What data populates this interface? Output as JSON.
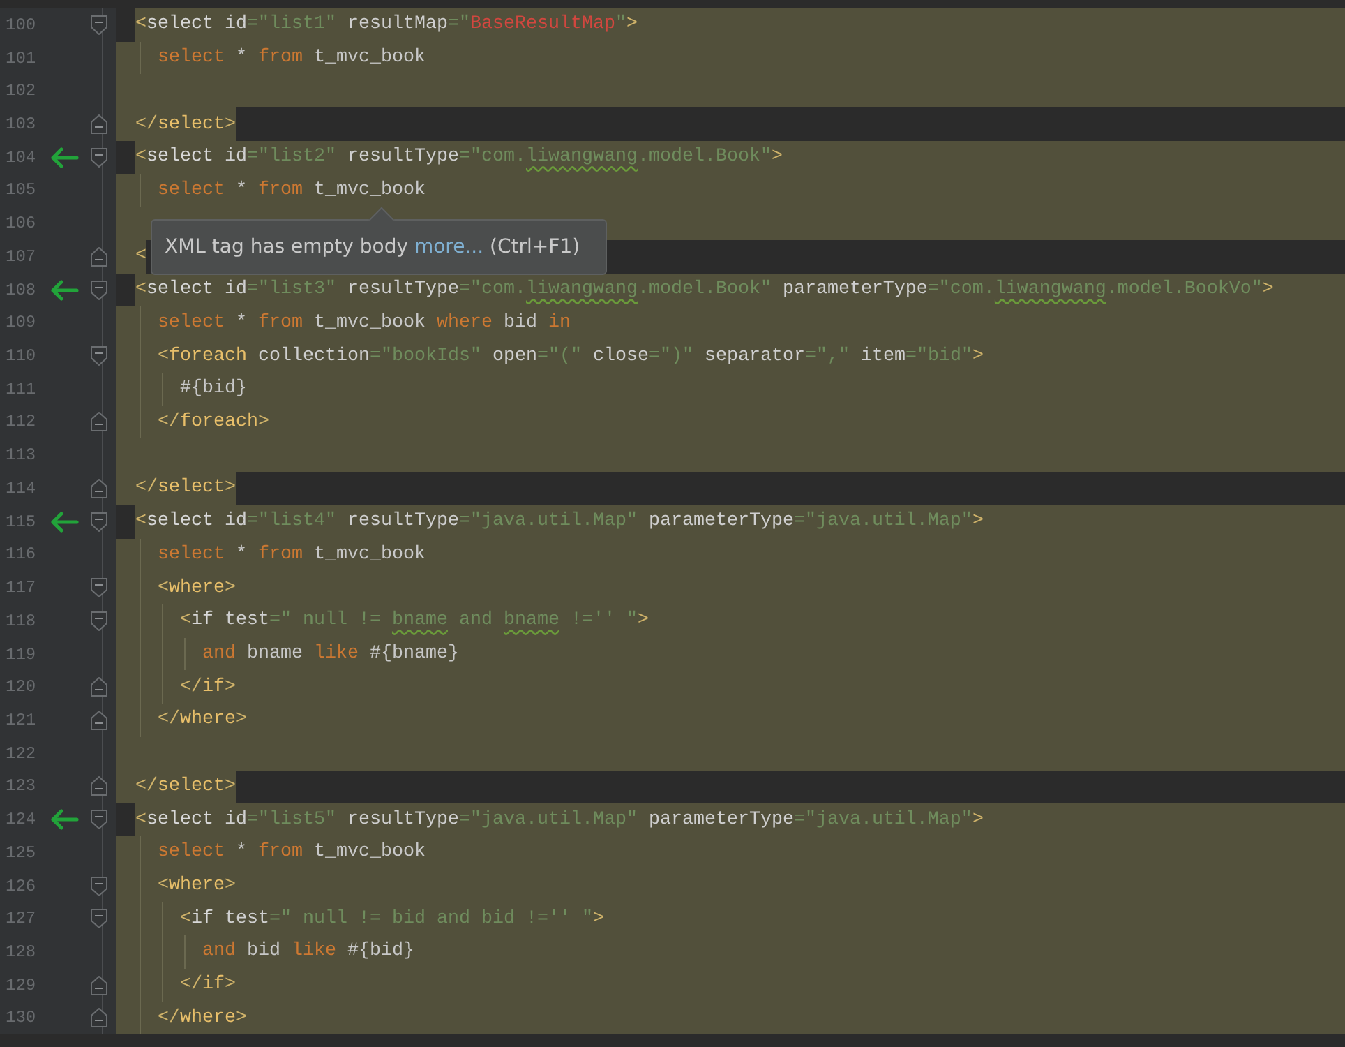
{
  "lines": [
    {
      "number": "100",
      "marker": false,
      "tokens": [
        {
          "kind": "bracket",
          "text": "<"
        },
        {
          "kind": "tag-plain",
          "text": "select"
        },
        {
          "kind": "attr",
          "text": " id"
        },
        {
          "kind": "value",
          "text": "=\"list1\""
        },
        {
          "kind": "attr",
          "text": " resultMap"
        },
        {
          "kind": "value",
          "text": "=\""
        },
        {
          "kind": "error",
          "text": "BaseResultMap"
        },
        {
          "kind": "value",
          "text": "\""
        },
        {
          "kind": "bracket",
          "text": ">"
        }
      ],
      "children": [
        {
          "number": "101",
          "marker": false,
          "tokens": [
            {
              "kind": "keyword",
              "text": "select"
            },
            {
              "kind": "text",
              "text": " * "
            },
            {
              "kind": "keyword",
              "text": "from"
            },
            {
              "kind": "text",
              "text": " t_mvc_book"
            }
          ]
        },
        {
          "number": "102",
          "marker": false
        }
      ]
    },
    {
      "number": "103",
      "marker": false,
      "tokens": [
        {
          "kind": "bracket",
          "text": "</"
        },
        {
          "kind": "tag",
          "text": "select"
        },
        {
          "kind": "bracket",
          "text": ">"
        }
      ]
    },
    {
      "number": "104",
      "marker": true,
      "tokens": [
        {
          "kind": "bracket",
          "text": "<"
        },
        {
          "kind": "tag-plain",
          "text": "select"
        },
        {
          "kind": "attr",
          "text": " id"
        },
        {
          "kind": "value",
          "text": "=\"list2\""
        },
        {
          "kind": "attr",
          "text": " resultType"
        },
        {
          "kind": "value",
          "text": "=\"com."
        },
        {
          "kind": "value",
          "text": "liwangwang",
          "warning": true
        },
        {
          "kind": "value",
          "text": ".model.Book\""
        },
        {
          "kind": "bracket",
          "text": ">"
        }
      ],
      "children": [
        {
          "number": "105",
          "marker": false,
          "tokens": [
            {
              "kind": "keyword",
              "text": "select"
            },
            {
              "kind": "text",
              "text": " * "
            },
            {
              "kind": "keyword",
              "text": "from"
            },
            {
              "kind": "text",
              "text": " t_mvc_book"
            }
          ]
        },
        {
          "number": "106",
          "marker": false
        }
      ]
    },
    {
      "number": "107",
      "marker": false,
      "tokens": [
        {
          "kind": "bracket",
          "text": "<"
        }
      ]
    },
    {
      "number": "108",
      "marker": true,
      "tokens": [
        {
          "kind": "bracket",
          "text": "<"
        },
        {
          "kind": "tag-plain",
          "text": "select"
        },
        {
          "kind": "attr",
          "text": " id"
        },
        {
          "kind": "value",
          "text": "=\"list3\""
        },
        {
          "kind": "attr",
          "text": " resultType"
        },
        {
          "kind": "value",
          "text": "=\"com."
        },
        {
          "kind": "value",
          "text": "liwangwang",
          "warning": true
        },
        {
          "kind": "value",
          "text": ".model.Book\""
        },
        {
          "kind": "attr",
          "text": " parameterType"
        },
        {
          "kind": "value",
          "text": "=\"com."
        },
        {
          "kind": "value",
          "text": "liwangwang",
          "warning": true
        },
        {
          "kind": "value",
          "text": ".model.BookVo\""
        },
        {
          "kind": "bracket",
          "text": ">"
        }
      ],
      "children": [
        {
          "number": "109",
          "marker": false,
          "tokens": [
            {
              "kind": "keyword",
              "text": "select"
            },
            {
              "kind": "text",
              "text": " * "
            },
            {
              "kind": "keyword",
              "text": "from"
            },
            {
              "kind": "text",
              "text": " t_mvc_book "
            },
            {
              "kind": "keyword",
              "text": "where"
            },
            {
              "kind": "text",
              "text": " bid "
            },
            {
              "kind": "keyword",
              "text": "in"
            }
          ]
        },
        {
          "number": "110",
          "marker": false,
          "tokens": [
            {
              "kind": "bracket",
              "text": "<"
            },
            {
              "kind": "tag",
              "text": "foreach"
            },
            {
              "kind": "attr",
              "text": " collection"
            },
            {
              "kind": "value",
              "text": "=\"bookIds\""
            },
            {
              "kind": "attr",
              "text": " open"
            },
            {
              "kind": "value",
              "text": "=\"(\""
            },
            {
              "kind": "attr",
              "text": " close"
            },
            {
              "kind": "value",
              "text": "=\")\""
            },
            {
              "kind": "attr",
              "text": " separator"
            },
            {
              "kind": "value",
              "text": "=\",\""
            },
            {
              "kind": "attr",
              "text": " item"
            },
            {
              "kind": "value",
              "text": "=\"bid\""
            },
            {
              "kind": "bracket",
              "text": ">"
            }
          ],
          "children": [
            {
              "number": "111",
              "marker": false,
              "tokens": [
                {
                  "kind": "text",
                  "text": "#{bid}"
                }
              ]
            }
          ]
        },
        {
          "number": "112",
          "marker": false,
          "tokens": [
            {
              "kind": "bracket",
              "text": "</"
            },
            {
              "kind": "tag",
              "text": "foreach"
            },
            {
              "kind": "bracket",
              "text": ">"
            }
          ]
        },
        {
          "number": "113",
          "marker": false
        }
      ]
    },
    {
      "number": "114",
      "marker": false,
      "tokens": [
        {
          "kind": "bracket",
          "text": "</"
        },
        {
          "kind": "tag",
          "text": "select"
        },
        {
          "kind": "bracket",
          "text": ">"
        }
      ]
    },
    {
      "number": "115",
      "marker": true,
      "tokens": [
        {
          "kind": "bracket",
          "text": "<"
        },
        {
          "kind": "tag-plain",
          "text": "select"
        },
        {
          "kind": "attr",
          "text": " id"
        },
        {
          "kind": "value",
          "text": "=\"list4\""
        },
        {
          "kind": "attr",
          "text": " resultType"
        },
        {
          "kind": "value",
          "text": "=\"java.util.Map\""
        },
        {
          "kind": "attr",
          "text": " parameterType"
        },
        {
          "kind": "value",
          "text": "=\"java.util.Map\""
        },
        {
          "kind": "bracket",
          "text": ">"
        }
      ],
      "children": [
        {
          "number": "116",
          "marker": false,
          "tokens": [
            {
              "kind": "keyword",
              "text": "select"
            },
            {
              "kind": "text",
              "text": " * "
            },
            {
              "kind": "keyword",
              "text": "from"
            },
            {
              "kind": "text",
              "text": " t_mvc_book"
            }
          ]
        },
        {
          "number": "117",
          "marker": false,
          "tokens": [
            {
              "kind": "bracket",
              "text": "<"
            },
            {
              "kind": "tag",
              "text": "where"
            },
            {
              "kind": "bracket",
              "text": ">"
            }
          ],
          "children": [
            {
              "number": "118",
              "marker": false,
              "tokens": [
                {
                  "kind": "bracket",
                  "text": "<"
                },
                {
                  "kind": "tag-plain",
                  "text": "if"
                },
                {
                  "kind": "attr",
                  "text": " test"
                },
                {
                  "kind": "value",
                  "text": "=\" null != "
                },
                {
                  "kind": "value",
                  "text": "bname",
                  "warning": true
                },
                {
                  "kind": "value",
                  "text": " and "
                },
                {
                  "kind": "value",
                  "text": "bname",
                  "warning": true
                },
                {
                  "kind": "value",
                  "text": " !='' \""
                },
                {
                  "kind": "bracket",
                  "text": ">"
                }
              ],
              "children": [
                {
                  "number": "119",
                  "marker": false,
                  "tokens": [
                    {
                      "kind": "keyword",
                      "text": "and"
                    },
                    {
                      "kind": "text",
                      "text": " bname "
                    },
                    {
                      "kind": "keyword",
                      "text": "like"
                    },
                    {
                      "kind": "text",
                      "text": " #{bname}"
                    }
                  ]
                }
              ]
            },
            {
              "number": "120",
              "marker": false,
              "tokens": [
                {
                  "kind": "bracket",
                  "text": "</"
                },
                {
                  "kind": "tag",
                  "text": "if"
                },
                {
                  "kind": "bracket",
                  "text": ">"
                }
              ]
            }
          ]
        },
        {
          "number": "121",
          "marker": false,
          "tokens": [
            {
              "kind": "bracket",
              "text": "</"
            },
            {
              "kind": "tag",
              "text": "where"
            },
            {
              "kind": "bracket",
              "text": ">"
            }
          ]
        },
        {
          "number": "122",
          "marker": false
        }
      ]
    },
    {
      "number": "123",
      "marker": false,
      "tokens": [
        {
          "kind": "bracket",
          "text": "</"
        },
        {
          "kind": "tag",
          "text": "select"
        },
        {
          "kind": "bracket",
          "text": ">"
        }
      ]
    },
    {
      "number": "124",
      "marker": true,
      "tokens": [
        {
          "kind": "bracket",
          "text": "<"
        },
        {
          "kind": "tag-plain",
          "text": "select"
        },
        {
          "kind": "attr",
          "text": " id"
        },
        {
          "kind": "value",
          "text": "=\"list5\""
        },
        {
          "kind": "attr",
          "text": " resultType"
        },
        {
          "kind": "value",
          "text": "=\"java.util.Map\""
        },
        {
          "kind": "attr",
          "text": " parameterType"
        },
        {
          "kind": "value",
          "text": "=\"java.util.Map\""
        },
        {
          "kind": "bracket",
          "text": ">"
        }
      ],
      "children": [
        {
          "number": "125",
          "marker": false,
          "tokens": [
            {
              "kind": "keyword",
              "text": "select"
            },
            {
              "kind": "text",
              "text": " * "
            },
            {
              "kind": "keyword",
              "text": "from"
            },
            {
              "kind": "text",
              "text": " t_mvc_book"
            }
          ]
        },
        {
          "number": "126",
          "marker": false,
          "tokens": [
            {
              "kind": "bracket",
              "text": "<"
            },
            {
              "kind": "tag",
              "text": "where"
            },
            {
              "kind": "bracket",
              "text": ">"
            }
          ],
          "children": [
            {
              "number": "127",
              "marker": false,
              "tokens": [
                {
                  "kind": "bracket",
                  "text": "<"
                },
                {
                  "kind": "tag-plain",
                  "text": "if"
                },
                {
                  "kind": "attr",
                  "text": " test"
                },
                {
                  "kind": "value",
                  "text": "=\" null != bid and bid !='' \""
                },
                {
                  "kind": "bracket",
                  "text": ">"
                }
              ],
              "children": [
                {
                  "number": "128",
                  "marker": false,
                  "tokens": [
                    {
                      "kind": "keyword",
                      "text": "and"
                    },
                    {
                      "kind": "text",
                      "text": " bid "
                    },
                    {
                      "kind": "keyword",
                      "text": "like"
                    },
                    {
                      "kind": "text",
                      "text": " #{bid}"
                    }
                  ]
                }
              ]
            },
            {
              "number": "129",
              "marker": false,
              "tokens": [
                {
                  "kind": "bracket",
                  "text": "</"
                },
                {
                  "kind": "tag",
                  "text": "if"
                },
                {
                  "kind": "bracket",
                  "text": ">"
                }
              ]
            }
          ]
        },
        {
          "number": "130",
          "marker": false,
          "tokens": [
            {
              "kind": "bracket",
              "text": "</"
            },
            {
              "kind": "tag",
              "text": "where"
            },
            {
              "kind": "bracket",
              "text": ">"
            }
          ]
        }
      ]
    }
  ],
  "tooltip": {
    "text": "XML tag has empty body",
    "link": "more...",
    "shortcut": "(Ctrl+F1)"
  }
}
